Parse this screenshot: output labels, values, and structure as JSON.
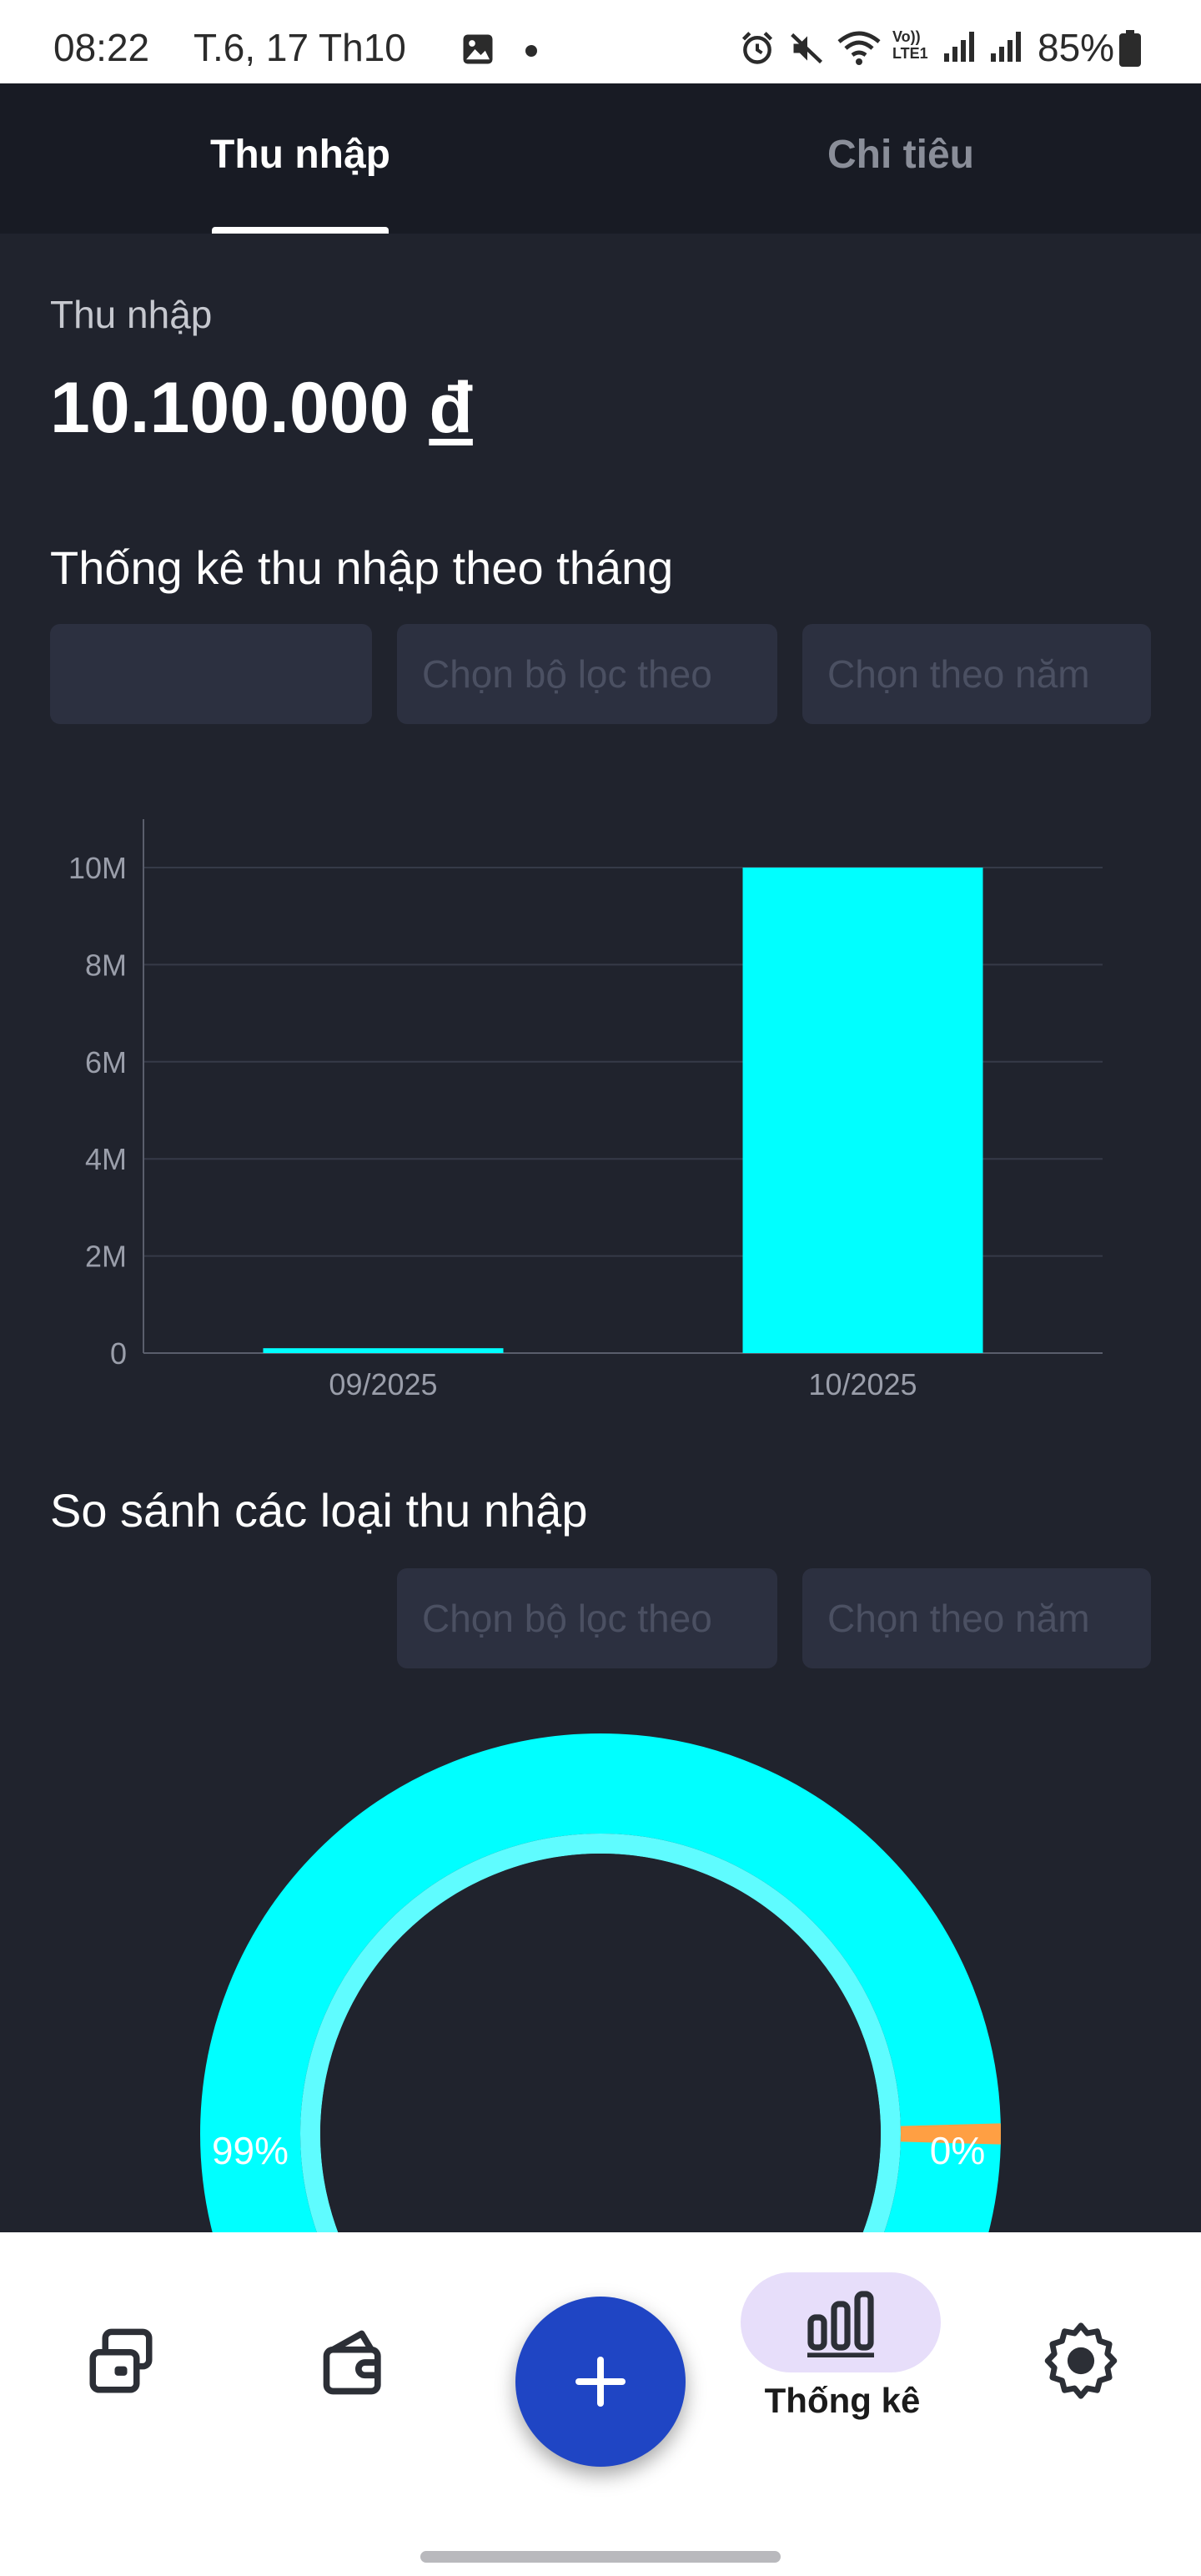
{
  "status_bar": {
    "time": "08:22",
    "date": "T.6, 17 Th10",
    "network_label_top": "Vo))",
    "network_label_bottom": "LTE1",
    "battery": "85%"
  },
  "tabs": [
    {
      "label": "Thu nhập",
      "active": true
    },
    {
      "label": "Chi tiêu",
      "active": false
    }
  ],
  "summary": {
    "label": "Thu nhập",
    "amount": "10.100.000",
    "currency": "đ"
  },
  "monthly_section": {
    "title": "Thống kê thu nhập theo tháng",
    "filter_empty": "",
    "filter_placeholder": "Chọn bộ lọc theo",
    "year_placeholder": "Chọn theo năm"
  },
  "compare_section": {
    "title": "So sánh các loại thu nhập",
    "filter_placeholder": "Chọn bộ lọc theo",
    "year_placeholder": "Chọn theo năm"
  },
  "chart_data": [
    {
      "type": "bar",
      "categories": [
        "09/2025",
        "10/2025"
      ],
      "values": [
        100000,
        10000000
      ],
      "ytick_labels": [
        "0",
        "2M",
        "4M",
        "6M",
        "8M",
        "10M"
      ],
      "ytick_values": [
        0,
        2000000,
        4000000,
        6000000,
        8000000,
        10000000
      ],
      "ylim": [
        0,
        11000000
      ],
      "grid": true,
      "color": "#00ffff"
    },
    {
      "type": "pie",
      "slices": [
        {
          "label": "99%",
          "value": 99,
          "color": "#00ffff"
        },
        {
          "label": "0%",
          "value": 0.3,
          "color": "#ff9f43"
        }
      ]
    }
  ],
  "bottom_nav": {
    "items": [
      {
        "icon": "wallet-cards-icon"
      },
      {
        "icon": "wallet-icon"
      },
      {
        "icon": "add-icon"
      },
      {
        "icon": "bar-chart-icon",
        "label": "Thống kê",
        "active": true
      },
      {
        "icon": "settings-gear-icon"
      }
    ],
    "stats_label": "Thống kê"
  },
  "colors": {
    "background": "#20232d",
    "tab_bar": "#181b24",
    "accent": "#00ffff",
    "fab": "#1f45c4",
    "active_pill": "#e7defa"
  }
}
